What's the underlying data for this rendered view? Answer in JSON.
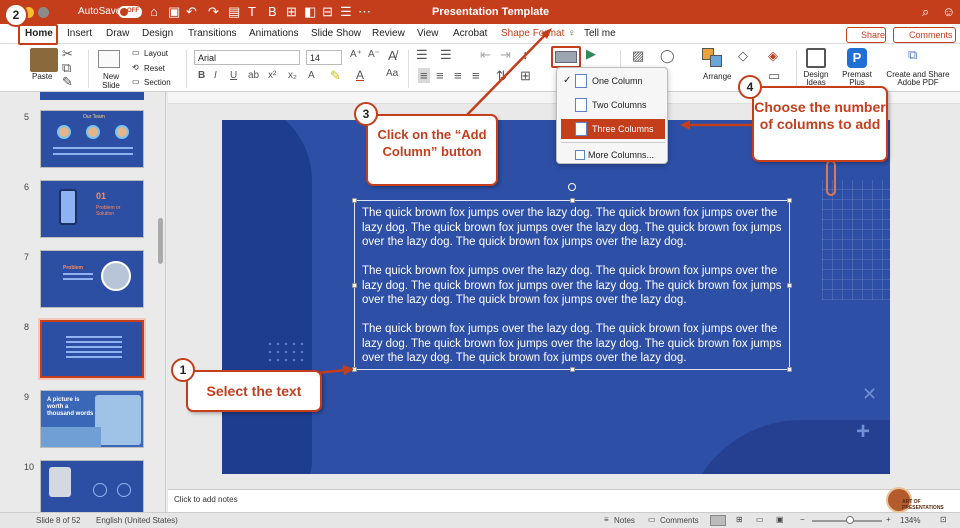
{
  "titlebar": {
    "autosave": "AutoSave",
    "toggle": "OFF",
    "title": "Presentation Template",
    "search": "Search"
  },
  "tabs": [
    "Home",
    "Insert",
    "Draw",
    "Design",
    "Transitions",
    "Animations",
    "Slide Show",
    "Review",
    "View",
    "Acrobat",
    "Shape Format"
  ],
  "tellme": "Tell me",
  "share": "Share",
  "comments": "Comments",
  "ribbon": {
    "paste": "Paste",
    "new_slide": "New Slide",
    "layout": "Layout",
    "reset": "Reset",
    "section": "Section",
    "font": "Arial",
    "size": "14",
    "arrange": "Arrange",
    "design_ideas": "Design Ideas",
    "premast": "Premast Plus",
    "create_share": "Create and Share Adobe PDF"
  },
  "dropdown": {
    "items": [
      "One Column",
      "Two Columns",
      "Three Columns"
    ],
    "more": "More Columns..."
  },
  "thumbs": {
    "numbers": [
      "5",
      "6",
      "7",
      "8",
      "9",
      "10"
    ],
    "t5_title": "Our Team",
    "t6_title": "01",
    "t6_sub": "Problem or Solution",
    "t7_title": "Problem",
    "t9_title": "A picture is worth a thousand words"
  },
  "slide": {
    "paragraphs": [
      "The quick brown fox jumps over the lazy dog. The quick brown fox jumps over the lazy dog. The quick brown fox jumps over the lazy dog. The quick brown fox jumps over the lazy dog. The quick brown fox jumps over the lazy dog.",
      "The quick brown fox jumps over the lazy dog. The quick brown fox jumps over the lazy dog. The quick brown fox jumps over the lazy dog. The quick brown fox jumps over the lazy dog. The quick brown fox jumps over the lazy dog.",
      "The quick brown fox jumps over the lazy dog. The quick brown fox jumps over the lazy dog. The quick brown fox jumps over the lazy dog. The quick brown fox jumps over the lazy dog. The quick brown fox jumps over the lazy dog."
    ]
  },
  "notes": "Click to add notes",
  "status": {
    "slide": "Slide 8 of 52",
    "language": "English (United States)",
    "notes": "Notes",
    "comments": "Comments",
    "zoom": "134%"
  },
  "callouts": {
    "c1": {
      "num": "1",
      "text": "Select the text"
    },
    "c2": {
      "num": "2"
    },
    "c3": {
      "num": "3",
      "text": "Click on the “Add Column” button"
    },
    "c4": {
      "num": "4",
      "text": "Choose the number of columns to add"
    }
  },
  "watermark": "ART OF PRESENTATIONS",
  "colors": {
    "accent": "#c43e1c",
    "slide_bg": "#2d4fa6"
  }
}
